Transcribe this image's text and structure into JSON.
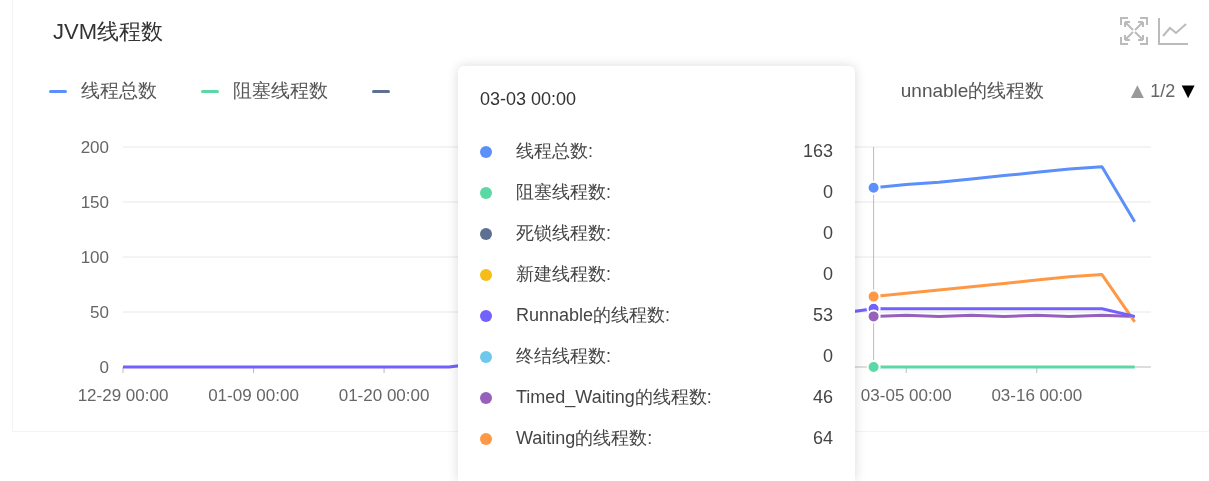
{
  "title": "JVM线程数",
  "toolbar": [
    {
      "kind": "expand"
    },
    {
      "kind": "chart"
    }
  ],
  "legend": {
    "items": [
      {
        "label": "线程总数",
        "color": "#5b8ff9"
      },
      {
        "label": "阻塞线程数",
        "color": "#5ad8a6"
      },
      {
        "color": "#5d7092"
      },
      {
        "label": "unnable的线程数"
      }
    ],
    "pager": {
      "prev": "▲",
      "prev_disabled": true,
      "page": "1/2",
      "next": "▼",
      "next_disabled": false
    }
  },
  "chart_data": {
    "type": "line",
    "categories": [
      "12-29 00:00",
      null,
      null,
      null,
      "01-09 00:00",
      null,
      null,
      null,
      "01-20 00:00",
      null,
      null,
      null,
      null,
      null,
      null,
      null,
      null,
      null,
      null,
      null,
      null,
      null,
      null,
      null,
      "03-05 00:00",
      null,
      null,
      null,
      "03-16 00:00",
      null,
      null,
      null
    ],
    "ylim": [
      0,
      200
    ],
    "yticks": [
      0,
      50,
      100,
      150,
      200
    ],
    "series": [
      {
        "color": "#5b8ff9",
        "values": [
          null,
          null,
          null,
          null,
          null,
          null,
          null,
          null,
          null,
          null,
          null,
          null,
          null,
          null,
          null,
          null,
          null,
          null,
          null,
          null,
          null,
          null,
          null,
          163,
          166,
          168,
          171,
          174,
          177,
          180,
          182,
          132
        ]
      },
      {
        "color": "#5ad8a6",
        "values": [
          null,
          null,
          null,
          null,
          null,
          null,
          null,
          null,
          null,
          null,
          null,
          null,
          null,
          null,
          null,
          null,
          null,
          null,
          null,
          null,
          null,
          null,
          null,
          0,
          0,
          0,
          0,
          0,
          0,
          0,
          0,
          0
        ]
      },
      {
        "color": "#9661bc",
        "values": [
          null,
          null,
          null,
          null,
          null,
          null,
          null,
          null,
          null,
          null,
          null,
          null,
          null,
          null,
          null,
          null,
          null,
          null,
          null,
          null,
          null,
          null,
          null,
          46,
          47,
          46,
          47,
          46,
          47,
          46,
          47,
          46
        ]
      },
      {
        "color": "#ff9845",
        "values": [
          null,
          null,
          null,
          null,
          null,
          null,
          null,
          null,
          null,
          null,
          null,
          null,
          null,
          null,
          null,
          null,
          null,
          null,
          null,
          null,
          null,
          null,
          null,
          64,
          67,
          70,
          73,
          76,
          79,
          82,
          84,
          41
        ]
      },
      {
        "color": "#7262fd",
        "values": [
          0,
          0,
          0,
          0,
          0,
          0,
          0,
          0,
          0,
          0,
          0,
          null,
          null,
          null,
          null,
          null,
          null,
          null,
          null,
          null,
          null,
          null,
          null,
          53,
          53,
          53,
          53,
          53,
          53,
          53,
          53,
          46
        ]
      }
    ],
    "grid": true
  },
  "tooltip": {
    "title": "03-03 00:00",
    "items": [
      {
        "label": "线程总数:",
        "value": "163",
        "color": "#5b8ff9"
      },
      {
        "label": "阻塞线程数:",
        "value": "0",
        "color": "#5ad8a6"
      },
      {
        "label": "死锁线程数:",
        "value": "0",
        "color": "#5d7092"
      },
      {
        "label": "新建线程数:",
        "value": "0",
        "color": "#f6bd16"
      },
      {
        "label": "Runnable的线程数:",
        "value": "53",
        "color": "#7262fd"
      },
      {
        "label": "终结线程数:",
        "value": "0",
        "color": "#6dc8ec"
      },
      {
        "label": "Timed_Waiting的线程数:",
        "value": "46",
        "color": "#9661bc"
      },
      {
        "label": "Waiting的线程数:",
        "value": "64",
        "color": "#ff9845"
      }
    ]
  }
}
